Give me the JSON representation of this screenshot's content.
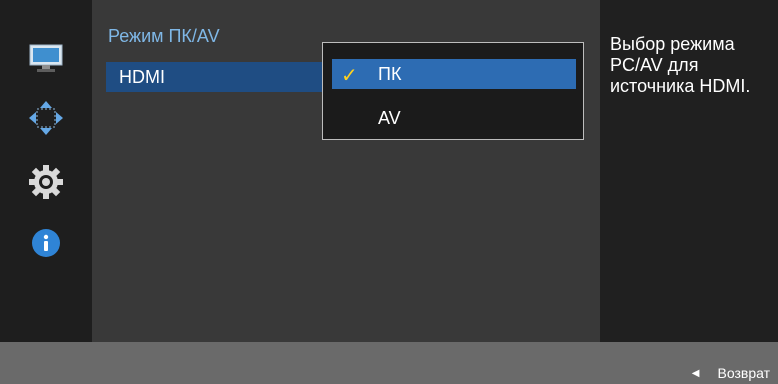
{
  "header": {
    "title": "Режим ПК/AV"
  },
  "menu": {
    "selected_item": "HDMI"
  },
  "dropdown": {
    "options": [
      {
        "label": "ПК",
        "selected": true,
        "icon": "check-icon"
      },
      {
        "label": "AV",
        "selected": false
      }
    ]
  },
  "help": {
    "text": "Выбор режима PC/AV для источника HDMI."
  },
  "footer": {
    "back_label": "Возврат"
  },
  "sidebar": {
    "icons": [
      "monitor-icon",
      "move-arrows-icon",
      "gear-icon",
      "info-icon"
    ]
  },
  "colors": {
    "accent": "#2d6cb3",
    "title": "#7fb7e6",
    "check": "#ffd21f"
  }
}
